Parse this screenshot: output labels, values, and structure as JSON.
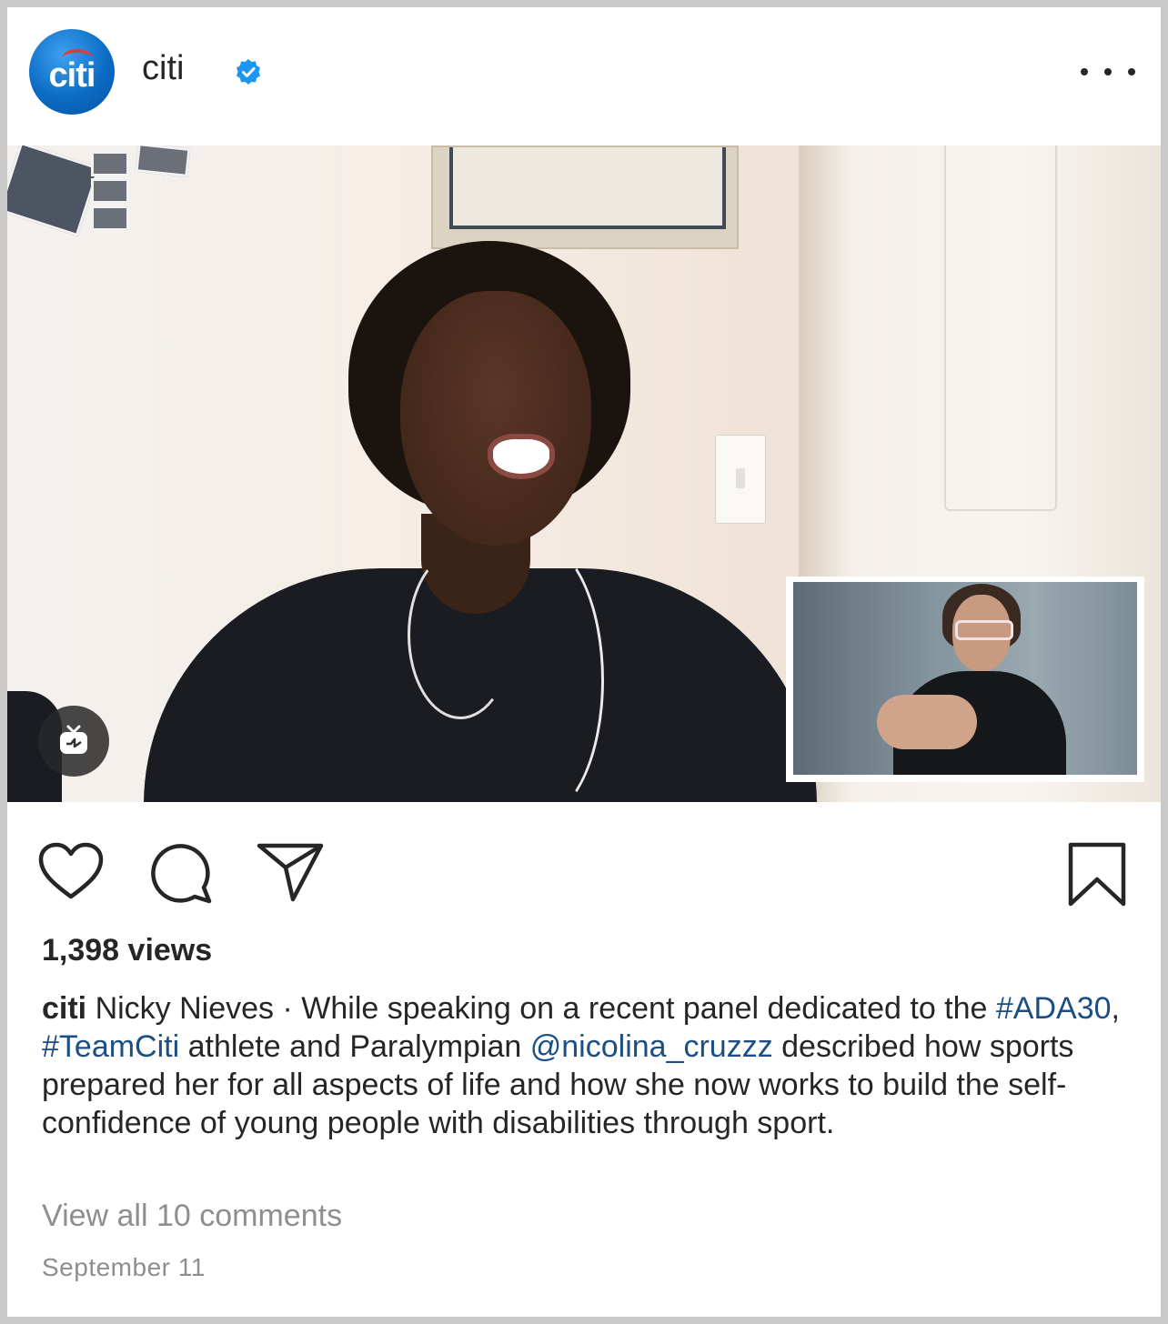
{
  "post": {
    "account": {
      "avatar_text": "citi",
      "username": "citi",
      "verified": true
    },
    "header_icons": {
      "verified": "verified-badge-icon",
      "more": "more-options-icon"
    },
    "media": {
      "type": "video",
      "badge_icon": "igtv-icon"
    },
    "actions": {
      "like": "heart-icon",
      "comment": "comment-bubble-icon",
      "share": "paper-plane-icon",
      "save": "bookmark-icon"
    },
    "views_text": "1,398 views",
    "caption": {
      "user": "citi",
      "segments": [
        {
          "type": "text",
          "value": " Nicky Nieves · While speaking on a recent panel dedicated to the "
        },
        {
          "type": "tag",
          "value": "#ADA30"
        },
        {
          "type": "text",
          "value": ", "
        },
        {
          "type": "tag",
          "value": "#TeamCiti"
        },
        {
          "type": "text",
          "value": " athlete and Paralympian "
        },
        {
          "type": "tag",
          "value": "@nicolina_cruzzz"
        },
        {
          "type": "text",
          "value": " described how sports prepared her for all aspects of life and how she now works to build the self-confidence of young people with disabilities through sport."
        }
      ]
    },
    "comments_link": "View all 10 comments",
    "date": "September 11"
  },
  "colors": {
    "verified_blue": "#1c96f0",
    "link_blue": "#1b4f84",
    "muted_gray": "#8e8e8e",
    "text": "#262626",
    "brand_blue": "#0b6cc4",
    "brand_red": "#e23a3a"
  }
}
